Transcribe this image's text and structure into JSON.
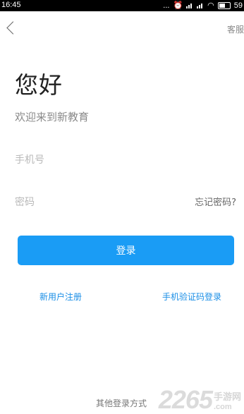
{
  "status_bar": {
    "time": "16:45",
    "dots": "...",
    "battery_level": "59"
  },
  "header": {
    "customer_service": "客服"
  },
  "main": {
    "greeting": "您好",
    "welcome": "欢迎来到新教育",
    "phone_placeholder": "手机号",
    "password_placeholder": "密码",
    "forgot_password": "忘记密码?",
    "login_button": "登录",
    "register_link": "新用户注册",
    "sms_login_link": "手机验证码登录"
  },
  "footer": {
    "other_login": "其他登录方式"
  },
  "watermark": {
    "number": "2265",
    "site_cn": "手游网",
    "site_domain": ".com"
  },
  "colors": {
    "accent": "#1a9cf5",
    "link": "#1a8ee6"
  }
}
